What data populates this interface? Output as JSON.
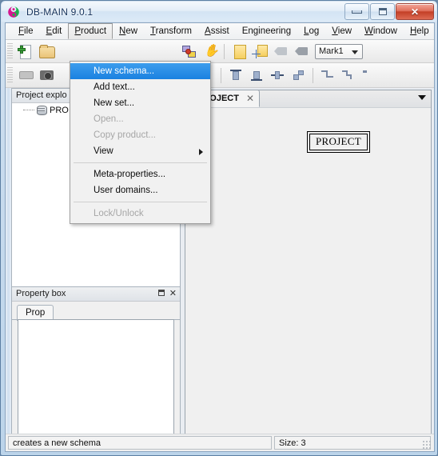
{
  "window": {
    "title": "DB-MAIN 9.0.1",
    "app_icon": "dbmain-logo-icon",
    "buttons": {
      "minimize": "minimize-button",
      "maximize": "maximize-button",
      "close": "✕"
    }
  },
  "menubar": {
    "items": [
      {
        "label": "File",
        "mnemonic": "F",
        "open": false
      },
      {
        "label": "Edit",
        "mnemonic": "E",
        "open": false
      },
      {
        "label": "Product",
        "mnemonic": "P",
        "open": true
      },
      {
        "label": "New",
        "mnemonic": "N",
        "open": false
      },
      {
        "label": "Transform",
        "mnemonic": "T",
        "open": false
      },
      {
        "label": "Assist",
        "mnemonic": "A",
        "open": false
      },
      {
        "label": "Engineering",
        "mnemonic": "g",
        "open": false
      },
      {
        "label": "Log",
        "mnemonic": "L",
        "open": false
      },
      {
        "label": "View",
        "mnemonic": "V",
        "open": false
      },
      {
        "label": "Window",
        "mnemonic": "W",
        "open": false
      },
      {
        "label": "Help",
        "mnemonic": "H",
        "open": false
      }
    ]
  },
  "dropdown": {
    "owner": "Product",
    "items": [
      {
        "label": "New schema...",
        "state": "selected"
      },
      {
        "label": "Add text...",
        "state": "normal"
      },
      {
        "label": "New set...",
        "state": "normal"
      },
      {
        "label": "Open...",
        "state": "disabled"
      },
      {
        "label": "Copy product...",
        "state": "disabled"
      },
      {
        "label": "View",
        "state": "submenu"
      },
      {
        "label": "---",
        "state": "separator"
      },
      {
        "label": "Meta-properties...",
        "state": "normal"
      },
      {
        "label": "User domains...",
        "state": "normal"
      },
      {
        "label": "---",
        "state": "separator"
      },
      {
        "label": "Lock/Unlock",
        "state": "disabled"
      }
    ]
  },
  "toolbar_top": {
    "icons": [
      "new-project-icon",
      "open-folder-icon",
      "entity-relation-icon",
      "pan-hand-icon",
      "new-note-icon",
      "add-note-icon",
      "erase-mark-icon",
      "mark-tag-icon"
    ],
    "mark_combo": {
      "value": "Mark1",
      "label": "mark-selector"
    }
  },
  "toolbar_bottom": {
    "icons": [
      "connect-icon",
      "snapshot-icon",
      "distribute-vertical-icon",
      "distribute-horizontal-icon",
      "align-top-icon",
      "align-bottom-icon",
      "align-center-h-icon",
      "align-center-v-icon",
      "route-step-icon",
      "route-zigzag-icon",
      "route-end-icon"
    ]
  },
  "explorer": {
    "title": "Project explo",
    "tree": [
      {
        "label": "PRO",
        "icon": "database-icon"
      }
    ]
  },
  "property_box": {
    "title": "Property box",
    "restore_icon": "restore-icon",
    "close_icon": "✕",
    "tabs": [
      {
        "label": "Prop",
        "active": true
      }
    ],
    "content": ""
  },
  "document": {
    "tab": {
      "label": "PROJECT",
      "close_icon": "✕"
    },
    "tab_menu_icon": "chevron-down-icon",
    "entity": {
      "name": "PROJECT"
    }
  },
  "statusbar": {
    "message": "creates a new schema",
    "size": "Size: 3",
    "resize_grip": "resize-grip-icon"
  },
  "colors": {
    "accent_selected": "#1a81e0",
    "close_button": "#c33f26",
    "window_frame": "#bcd4ea",
    "panel_bg": "#f0f0f0"
  }
}
